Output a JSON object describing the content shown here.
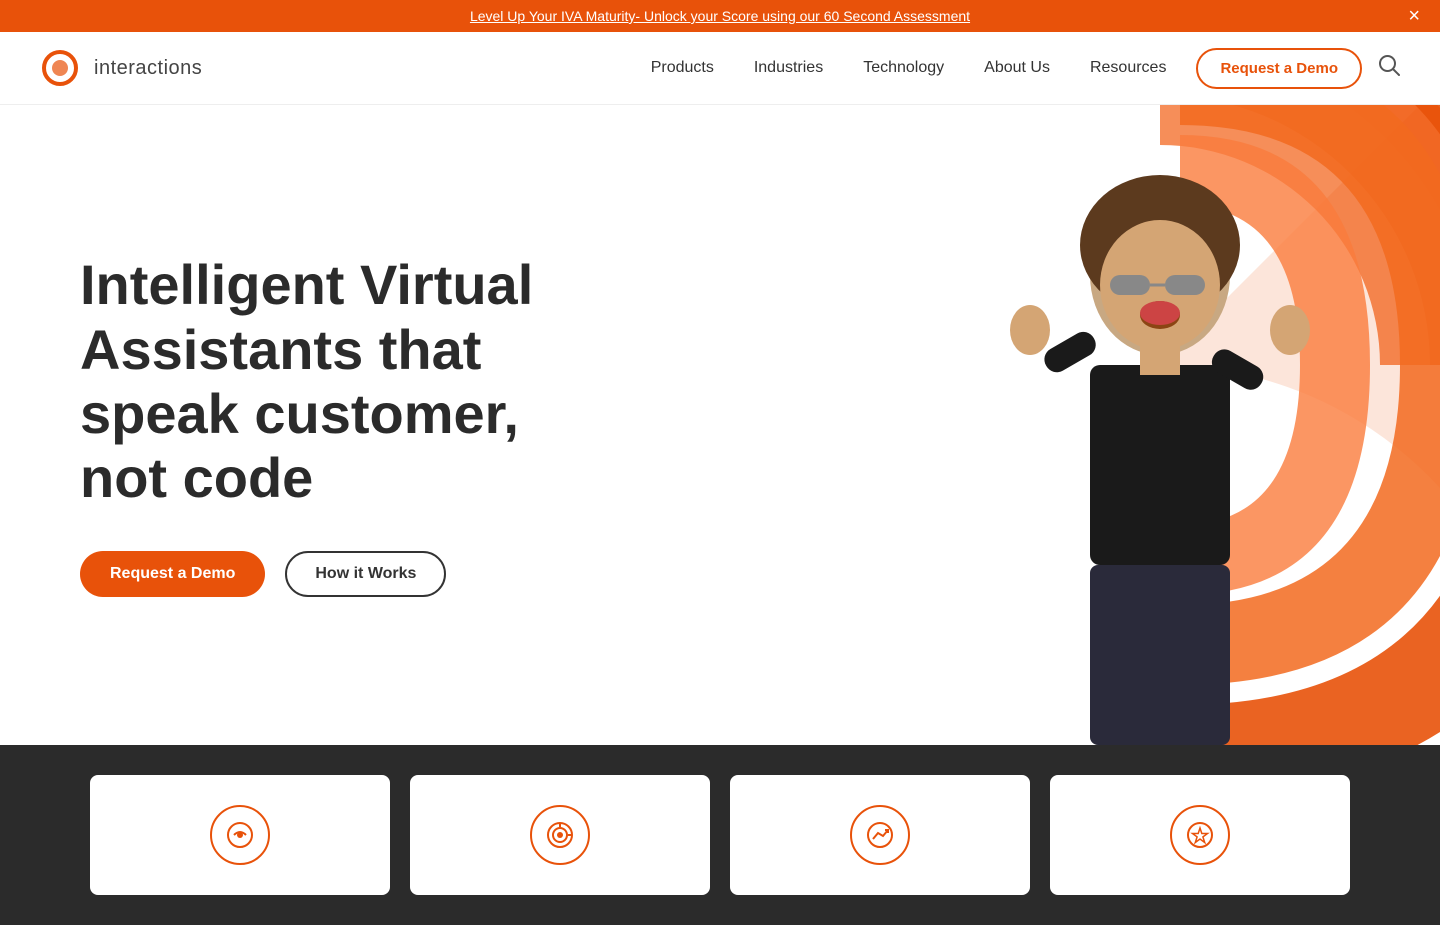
{
  "banner": {
    "text": "Level Up Your IVA Maturity- Unlock your Score using our 60 Second Assessment",
    "close_label": "×"
  },
  "navbar": {
    "logo_text": "interactions",
    "nav_items": [
      {
        "label": "Products",
        "id": "products"
      },
      {
        "label": "Industries",
        "id": "industries"
      },
      {
        "label": "Technology",
        "id": "technology"
      },
      {
        "label": "About Us",
        "id": "about"
      },
      {
        "label": "Resources",
        "id": "resources"
      }
    ],
    "cta_label": "Request a Demo",
    "search_label": "🔍"
  },
  "hero": {
    "title": "Intelligent Virtual Assistants that speak customer, not code",
    "btn_primary": "Request a Demo",
    "btn_secondary": "How it Works"
  },
  "cards": [
    {
      "icon": "💬",
      "id": "card-1"
    },
    {
      "icon": "🎯",
      "id": "card-2"
    },
    {
      "icon": "📈",
      "id": "card-3"
    },
    {
      "icon": "⭐",
      "id": "card-4"
    }
  ]
}
